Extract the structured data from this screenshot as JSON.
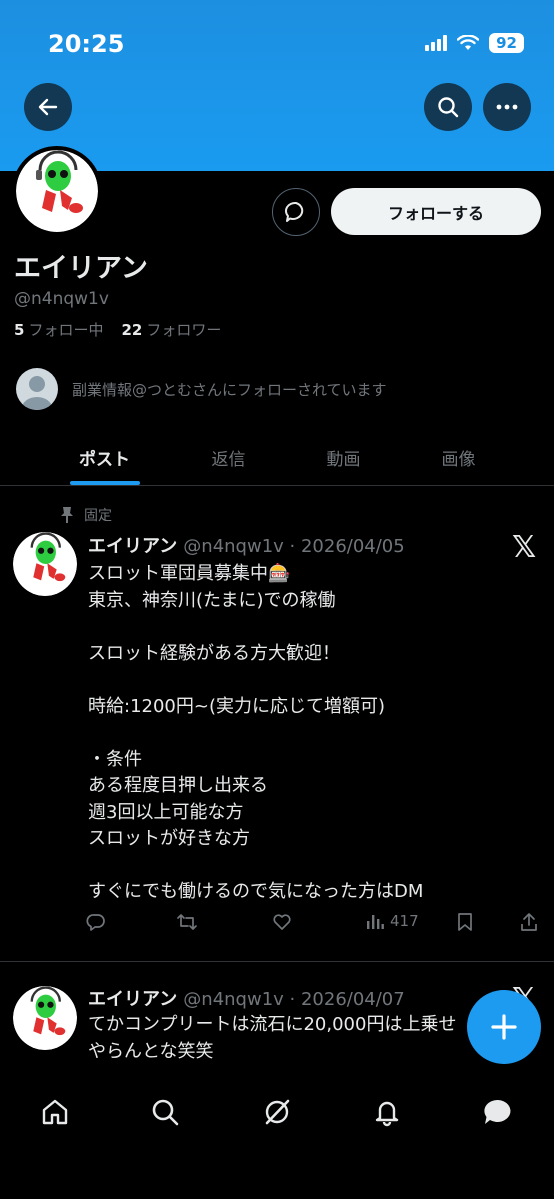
{
  "status_bar": {
    "time": "20:25",
    "battery": "92"
  },
  "profile": {
    "display_name": "エイリアン",
    "handle": "@n4nqw1v",
    "following_count": "5",
    "following_label": "フォロー中",
    "followers_count": "22",
    "followers_label": "フォロワー",
    "followed_by_text": "副業情報@つとむさんにフォローされています",
    "follow_button_label": "フォローする"
  },
  "tabs": [
    {
      "label": "ポスト",
      "active": true
    },
    {
      "label": "返信",
      "active": false
    },
    {
      "label": "動画",
      "active": false
    },
    {
      "label": "画像",
      "active": false
    }
  ],
  "pinned_label": "固定",
  "posts": [
    {
      "name": "エイリアン",
      "handle_date": "@n4nqw1v · 2026/04/05",
      "text": "スロット軍団員募集中🎰\n東京、神奈川(たまに)での稼働\n\nスロット経験がある方大歓迎！\n\n時給:1200円~(実力に応じて増額可)\n\n・条件\nある程度目押し出来る\n週3回以上可能な方\nスロットが好きな方\n\nすぐにでも働けるので気になった方はDM",
      "views": "417"
    },
    {
      "name": "エイリアン",
      "handle_date": "@n4nqw1v · 2026/04/07",
      "text": "てかコンプリートは流石に20,000円は上乗せ\nやらんとな笑笑"
    }
  ],
  "colors": {
    "accent": "#1d9bf0",
    "banner": "#1a9bf0",
    "muted": "#71767b",
    "text": "#e7e9ea"
  },
  "icons": [
    "back-arrow-icon",
    "search-icon",
    "more-icon",
    "dm-bubble-icon",
    "pin-icon",
    "x-logo-icon",
    "reply-icon",
    "repost-icon",
    "like-icon",
    "views-icon",
    "bookmark-icon",
    "share-icon",
    "compose-plus-icon",
    "home-icon",
    "explore-icon",
    "grok-icon",
    "notifications-icon",
    "messages-icon"
  ]
}
